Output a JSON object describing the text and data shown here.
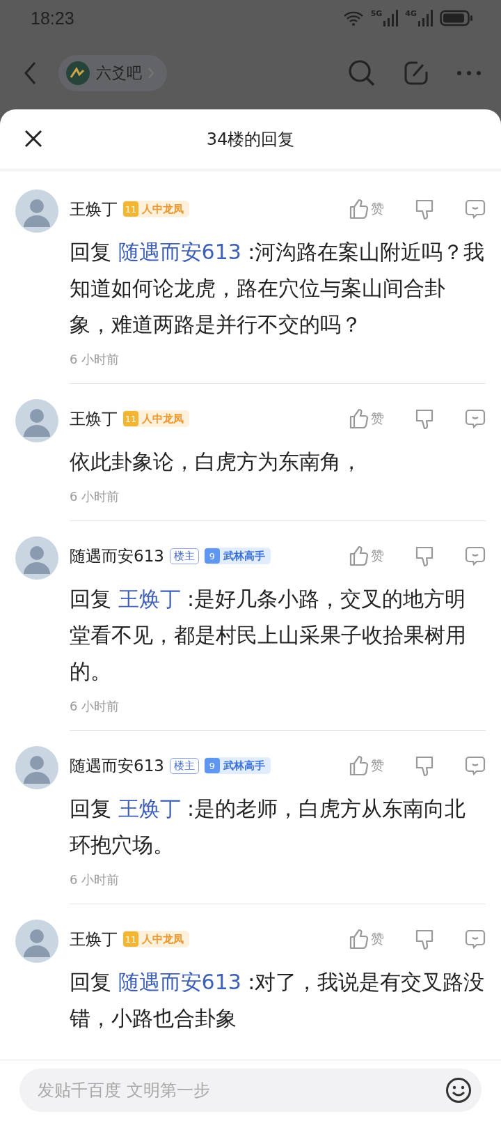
{
  "status_bar": {
    "time": "18:23",
    "network_1": "5G",
    "network_2": "4G"
  },
  "top_bar": {
    "forum": "六爻吧"
  },
  "sheet": {
    "title": "34楼的回复"
  },
  "comments": [
    {
      "author": "王焕丁",
      "badges": [
        {
          "kind": "level",
          "number": "11",
          "title": "人中龙凤"
        }
      ],
      "reply_prefix": "回复",
      "reply_to": "随遇而安613",
      "text": ":河沟路在案山附近吗？我知道如何论龙虎，路在穴位与案山间合卦象，难道两路是并行不交的吗？",
      "time": "6 小时前",
      "like": "赞"
    },
    {
      "author": "王焕丁",
      "badges": [
        {
          "kind": "level",
          "number": "11",
          "title": "人中龙凤"
        }
      ],
      "text": "依此卦象论，白虎方为东南角，",
      "time": "6 小时前",
      "like": "赞"
    },
    {
      "author": "随遇而安613",
      "badges": [
        {
          "kind": "owner",
          "title": "楼主"
        },
        {
          "kind": "level_blue",
          "number": "9",
          "title": "武林高手"
        }
      ],
      "reply_prefix": "回复",
      "reply_to": "王焕丁",
      "text": ":是好几条小路，交叉的地方明堂看不见，都是村民上山采果子收拾果树用的。",
      "time": "6 小时前",
      "like": "赞"
    },
    {
      "author": "随遇而安613",
      "badges": [
        {
          "kind": "owner",
          "title": "楼主"
        },
        {
          "kind": "level_blue",
          "number": "9",
          "title": "武林高手"
        }
      ],
      "reply_prefix": "回复",
      "reply_to": "王焕丁",
      "text": ":是的老师，白虎方从东南向北环抱穴场。",
      "time": "6 小时前",
      "like": "赞"
    },
    {
      "author": "王焕丁",
      "badges": [
        {
          "kind": "level",
          "number": "11",
          "title": "人中龙凤"
        }
      ],
      "reply_prefix": "回复",
      "reply_to": "随遇而安613",
      "text": ":对了，我说是有交叉路没错，小路也合卦象",
      "like": "赞"
    }
  ],
  "composer": {
    "placeholder": "发贴千百度 文明第一步"
  }
}
